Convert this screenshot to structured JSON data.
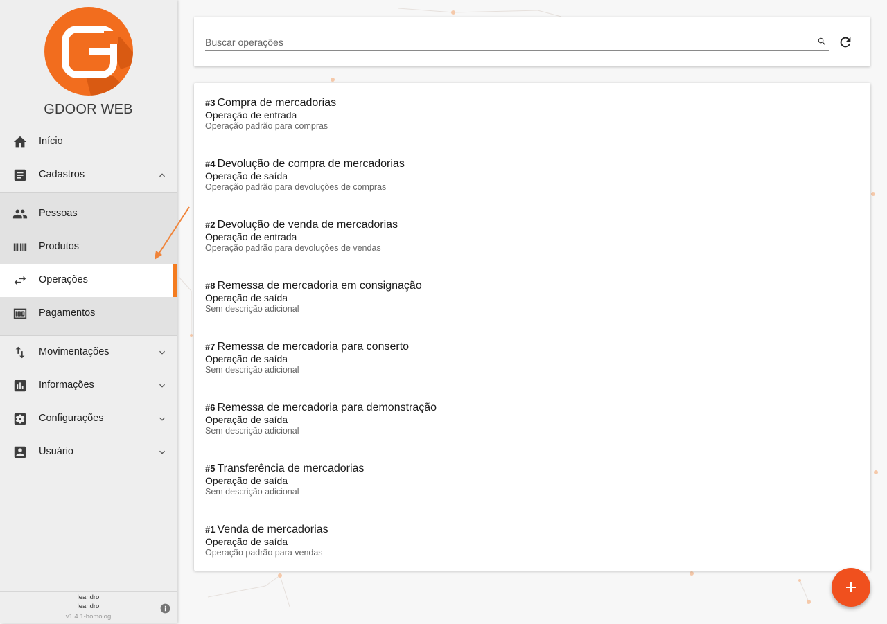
{
  "app": {
    "name": "GDOOR WEB"
  },
  "colors": {
    "accent": "#f47c20",
    "fab": "#f0501e",
    "logo": "#f26d1e"
  },
  "sidebar": {
    "items": [
      {
        "label": "Início",
        "icon": "home-icon"
      },
      {
        "label": "Cadastros",
        "icon": "document-icon",
        "expanded": true
      },
      {
        "label": "Pessoas",
        "icon": "people-icon"
      },
      {
        "label": "Produtos",
        "icon": "barcode-icon"
      },
      {
        "label": "Operações",
        "icon": "swap-arrows-icon",
        "active": true
      },
      {
        "label": "Pagamentos",
        "icon": "money-icon"
      },
      {
        "label": "Movimentações",
        "icon": "import-export-icon"
      },
      {
        "label": "Informações",
        "icon": "bar-chart-icon"
      },
      {
        "label": "Configurações",
        "icon": "gear-icon"
      },
      {
        "label": "Usuário",
        "icon": "account-box-icon"
      }
    ],
    "footer": {
      "user_line1": "leandro",
      "user_line2": "leandro",
      "version": "v1.4.1-homolog"
    }
  },
  "search": {
    "placeholder": "Buscar operações",
    "value": ""
  },
  "operations": [
    {
      "number": "#3",
      "title": "Compra de mercadorias",
      "type": "Operação de entrada",
      "description": "Operação padrão para compras"
    },
    {
      "number": "#4",
      "title": "Devolução de compra de mercadorias",
      "type": "Operação de saída",
      "description": "Operação padrão para devoluções de compras"
    },
    {
      "number": "#2",
      "title": "Devolução de venda de mercadorias",
      "type": "Operação de entrada",
      "description": "Operação padrão para devoluções de vendas"
    },
    {
      "number": "#8",
      "title": "Remessa de mercadoria em consignação",
      "type": "Operação de saída",
      "description": "Sem descrição adicional"
    },
    {
      "number": "#7",
      "title": "Remessa de mercadoria para conserto",
      "type": "Operação de saída",
      "description": "Sem descrição adicional"
    },
    {
      "number": "#6",
      "title": "Remessa de mercadoria para demonstração",
      "type": "Operação de saída",
      "description": "Sem descrição adicional"
    },
    {
      "number": "#5",
      "title": "Transferência de mercadorias",
      "type": "Operação de saída",
      "description": "Sem descrição adicional"
    },
    {
      "number": "#1",
      "title": "Venda de mercadorias",
      "type": "Operação de saída",
      "description": "Operação padrão para vendas"
    }
  ]
}
